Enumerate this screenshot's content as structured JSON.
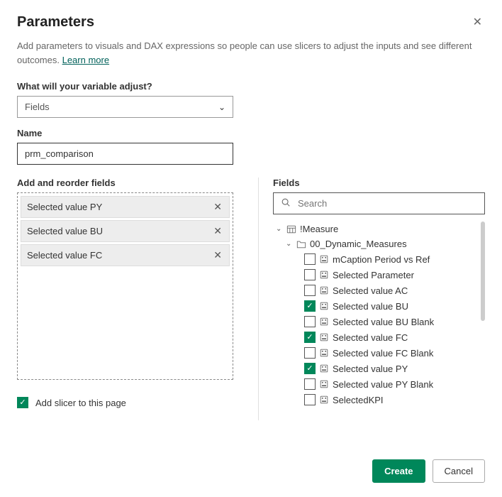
{
  "header": {
    "title": "Parameters",
    "intro_text": "Add parameters to visuals and DAX expressions so people can use slicers to adjust the inputs and see different outcomes. ",
    "learn_more": "Learn more"
  },
  "variable_adjust": {
    "label": "What will your variable adjust?",
    "value": "Fields"
  },
  "name_field": {
    "label": "Name",
    "value": "prm_comparison"
  },
  "reorder": {
    "label": "Add and reorder fields",
    "items": [
      {
        "label": "Selected value PY"
      },
      {
        "label": "Selected value BU"
      },
      {
        "label": "Selected value FC"
      }
    ]
  },
  "slicer_checkbox": {
    "checked": true,
    "label": "Add slicer to this page"
  },
  "fields_panel": {
    "label": "Fields",
    "search_placeholder": "Search",
    "tree": {
      "table": "!Measure",
      "folder": "00_Dynamic_Measures",
      "items": [
        {
          "label": "mCaption Period vs Ref",
          "checked": false
        },
        {
          "label": "Selected Parameter",
          "checked": false
        },
        {
          "label": "Selected value AC",
          "checked": false
        },
        {
          "label": "Selected value BU",
          "checked": true
        },
        {
          "label": "Selected value BU Blank",
          "checked": false
        },
        {
          "label": "Selected value FC",
          "checked": true
        },
        {
          "label": "Selected value FC Blank",
          "checked": false
        },
        {
          "label": "Selected value PY",
          "checked": true
        },
        {
          "label": "Selected value PY Blank",
          "checked": false
        },
        {
          "label": "SelectedKPI",
          "checked": false
        }
      ]
    }
  },
  "footer": {
    "create": "Create",
    "cancel": "Cancel"
  }
}
